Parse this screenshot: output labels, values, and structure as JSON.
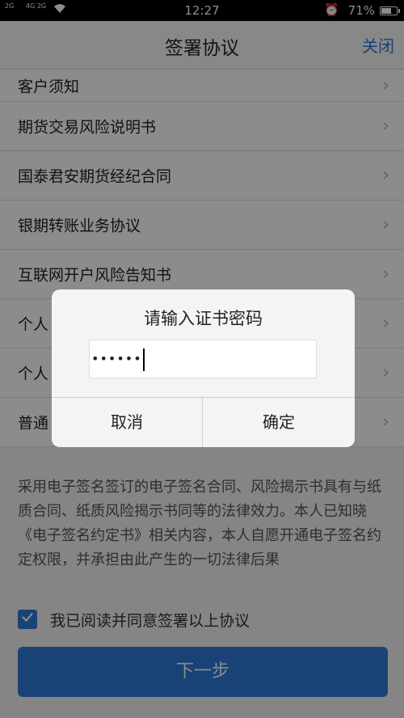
{
  "status_bar": {
    "signal1": "2G",
    "signal2": "4G 2G",
    "time": "12:27",
    "battery_pct": "71%",
    "battery_level": 0.71
  },
  "nav": {
    "title": "签署协议",
    "close_label": "关闭"
  },
  "list": {
    "items": [
      {
        "label": "客户须知"
      },
      {
        "label": "期货交易风险说明书"
      },
      {
        "label": "国泰君安期货经纪合同"
      },
      {
        "label": "银期转账业务协议"
      },
      {
        "label": "互联网开户风险告知书"
      },
      {
        "label": "个人"
      },
      {
        "label": "个人"
      },
      {
        "label": "普通"
      }
    ]
  },
  "notice": {
    "text": "采用电子签名签订的电子签名合同、风险揭示书具有与纸质合同、纸质风险揭示书同等的法律效力。本人已知晓《电子签名约定书》相关内容，本人自愿开通电子签名约定权限，并承担由此产生的一切法律后果"
  },
  "agree": {
    "checked": true,
    "label": "我已阅读并同意签署以上协议"
  },
  "next_button": {
    "label": "下一步"
  },
  "dialog": {
    "title": "请输入证书密码",
    "password_value": "••••••",
    "cancel_label": "取消",
    "confirm_label": "确定"
  },
  "colors": {
    "accent": "#2f7ad8"
  }
}
